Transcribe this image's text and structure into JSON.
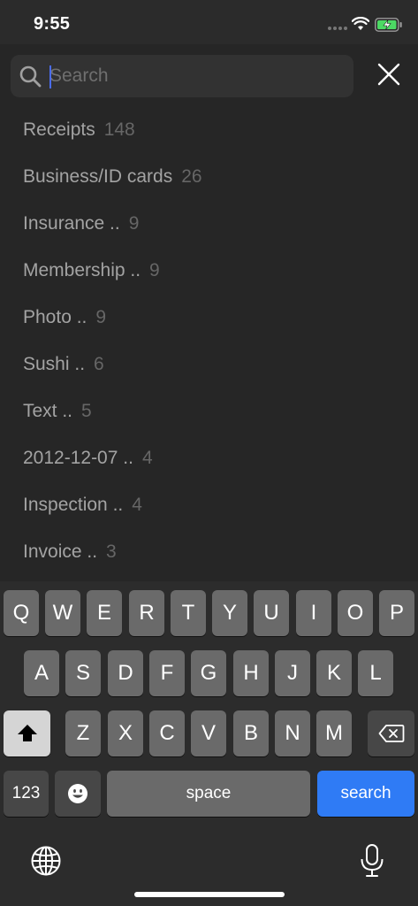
{
  "status": {
    "time": "9:55"
  },
  "search": {
    "placeholder": "Search",
    "value": ""
  },
  "tags": [
    {
      "name": "Receipts",
      "count": "148"
    },
    {
      "name": "Business/ID cards",
      "count": "26"
    },
    {
      "name": "Insurance ..",
      "count": "9"
    },
    {
      "name": "Membership ..",
      "count": "9"
    },
    {
      "name": "Photo ..",
      "count": "9"
    },
    {
      "name": "Sushi ..",
      "count": "6"
    },
    {
      "name": "Text ..",
      "count": "5"
    },
    {
      "name": "2012-12-07 ..",
      "count": "4"
    },
    {
      "name": "Inspection ..",
      "count": "4"
    },
    {
      "name": "Invoice ..",
      "count": "3"
    }
  ],
  "keyboard": {
    "row1": [
      "Q",
      "W",
      "E",
      "R",
      "T",
      "Y",
      "U",
      "I",
      "O",
      "P"
    ],
    "row2": [
      "A",
      "S",
      "D",
      "F",
      "G",
      "H",
      "J",
      "K",
      "L"
    ],
    "row3": [
      "Z",
      "X",
      "C",
      "V",
      "B",
      "N",
      "M"
    ],
    "num_label": "123",
    "space_label": "space",
    "search_label": "search"
  },
  "colors": {
    "accent": "#2f7bf5",
    "background": "#262626",
    "key": "#6a6a6a"
  },
  "icons": [
    "search-icon",
    "close-icon",
    "shift-icon",
    "backspace-icon",
    "emoji-icon",
    "globe-icon",
    "microphone-icon"
  ]
}
